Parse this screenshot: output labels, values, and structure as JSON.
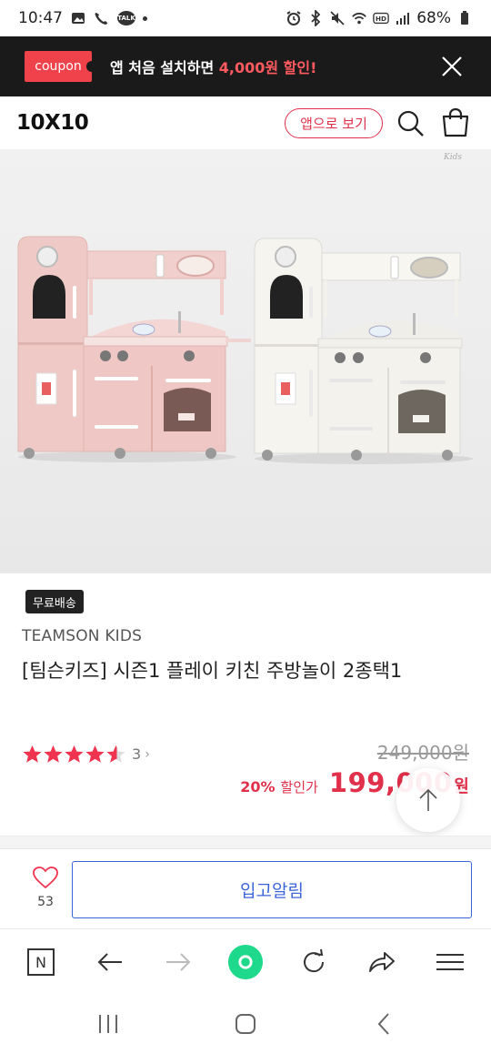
{
  "status_bar": {
    "time": "10:47",
    "battery": "68%",
    "talk_label": "TALK"
  },
  "coupon": {
    "tag": "coupon",
    "text_prefix": "앱 처음 설치하면 ",
    "text_amount": "4,000원 할인!"
  },
  "header": {
    "logo": "10X10",
    "app_view": "앱으로 보기"
  },
  "product": {
    "image_watermark": "Kids",
    "free_shipping": "무료배송",
    "brand": "TEAMSON KIDS",
    "name": "[팀슨키즈] 시즌1 플레이 키친 주방놀이 2종택1",
    "rating": 4.5,
    "review_count": "3",
    "review_chevron": "›",
    "original_price": "249,000원",
    "discount_percent": "20%",
    "discount_label": "할인가",
    "sale_price": "199,000",
    "sale_currency": "원"
  },
  "action": {
    "wish_count": "53",
    "notify_label": "입고알림"
  },
  "browser": {
    "home_label": "N"
  },
  "colors": {
    "accent_red": "#e0304a",
    "notify_blue": "#3b64d8",
    "banner_bg": "#1a1a1a",
    "whale_green": "#1ed98c"
  }
}
